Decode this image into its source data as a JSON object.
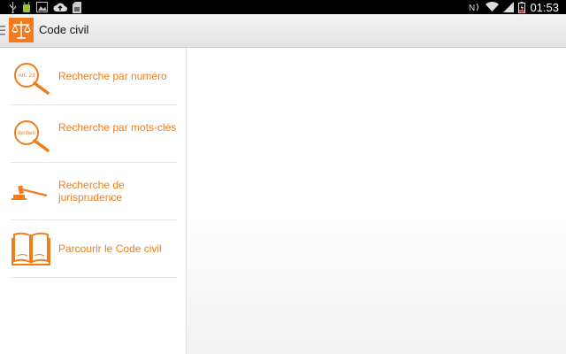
{
  "status_bar": {
    "time": "01:53",
    "left_icons": [
      "usb-icon",
      "android-debug-icon",
      "image-icon",
      "cloud-upload-icon",
      "sd-card-icon"
    ],
    "right_icons": [
      "nfc-icon",
      "wifi-icon",
      "signal-icon",
      "battery-charging-icon"
    ]
  },
  "action_bar": {
    "title": "Code civil",
    "accent_color": "#f47a20"
  },
  "nav": {
    "items": [
      {
        "label": "Recherche par numéro",
        "icon": "magnifier-article-icon",
        "icon_text": "Art. 23"
      },
      {
        "label": "Recherche par mots-clés",
        "icon": "magnifier-keyword-icon",
        "icon_text": "deshen"
      },
      {
        "label": "Recherche de jurisprudence",
        "icon": "gavel-icon"
      },
      {
        "label": "Parcourir le Code civil",
        "icon": "open-book-icon"
      }
    ]
  },
  "colors": {
    "accent": "#f07d1a",
    "divider": "#e7e7e7"
  }
}
